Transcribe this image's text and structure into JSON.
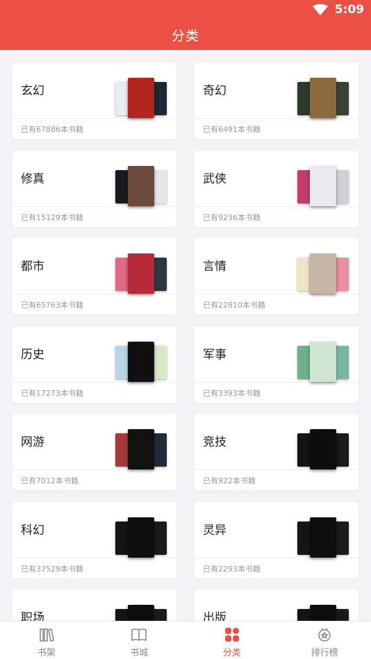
{
  "status_bar": {
    "time": "5:09"
  },
  "header": {
    "title": "分类"
  },
  "categories": [
    {
      "name": "玄幻",
      "count": "已有67886本书籍",
      "covers": [
        "#e7ecf2",
        "#b3251e",
        "#1f2733"
      ]
    },
    {
      "name": "奇幻",
      "count": "已有6491本书籍",
      "covers": [
        "#2c3a2d",
        "#8a6a3a",
        "#3a4038"
      ]
    },
    {
      "name": "修真",
      "count": "已有15129本书籍",
      "covers": [
        "#1a1a22",
        "#6b4a3a",
        "#e5e5ea"
      ]
    },
    {
      "name": "武侠",
      "count": "已有9236本书籍",
      "covers": [
        "#c43a6c",
        "#e9e9ee",
        "#cfcfd6"
      ]
    },
    {
      "name": "都市",
      "count": "已有65763本书籍",
      "covers": [
        "#e06a84",
        "#b82a3a",
        "#303640"
      ]
    },
    {
      "name": "言情",
      "count": "已有22810本书籍",
      "covers": [
        "#efe3c8",
        "#c7b6a4",
        "#e88fa0"
      ]
    },
    {
      "name": "历史",
      "count": "已有17273本书籍",
      "covers": [
        "#b8d6e8",
        "#111111",
        "#d9e8c9"
      ]
    },
    {
      "name": "军事",
      "count": "已有3393本书籍",
      "covers": [
        "#6cb08a",
        "#cfe6d2",
        "#7ab7a0"
      ]
    },
    {
      "name": "网游",
      "count": "已有7012本书籍",
      "covers": [
        "#a63a3a",
        "#121212",
        "#222a35"
      ]
    },
    {
      "name": "竞技",
      "count": "已有922本书籍",
      "covers": [
        "#141414",
        "#0d0d0d",
        "#1a1a1a"
      ]
    },
    {
      "name": "科幻",
      "count": "已有37529本书籍",
      "covers": [
        "#151515",
        "#0e0e0e",
        "#1b1b1b"
      ]
    },
    {
      "name": "灵异",
      "count": "已有2293本书籍",
      "covers": [
        "#151515",
        "#0e0e0e",
        "#1b1b1b"
      ]
    },
    {
      "name": "职场",
      "count": "",
      "covers": [
        "#151515",
        "#0e0e0e",
        "#1b1b1b"
      ]
    },
    {
      "name": "出版",
      "count": "",
      "covers": [
        "#151515",
        "#0e0e0e",
        "#1b1b1b"
      ]
    }
  ],
  "tabbar": {
    "items": [
      {
        "label": "书架",
        "icon": "bookshelf-icon"
      },
      {
        "label": "书城",
        "icon": "open-book-icon"
      },
      {
        "label": "分类",
        "icon": "category-icon"
      },
      {
        "label": "排行榜",
        "icon": "ranking-medal-icon"
      }
    ],
    "active_index": 2
  },
  "colors": {
    "accent": "#eb5045",
    "background": "#f3f3f6",
    "card": "#ffffff"
  }
}
